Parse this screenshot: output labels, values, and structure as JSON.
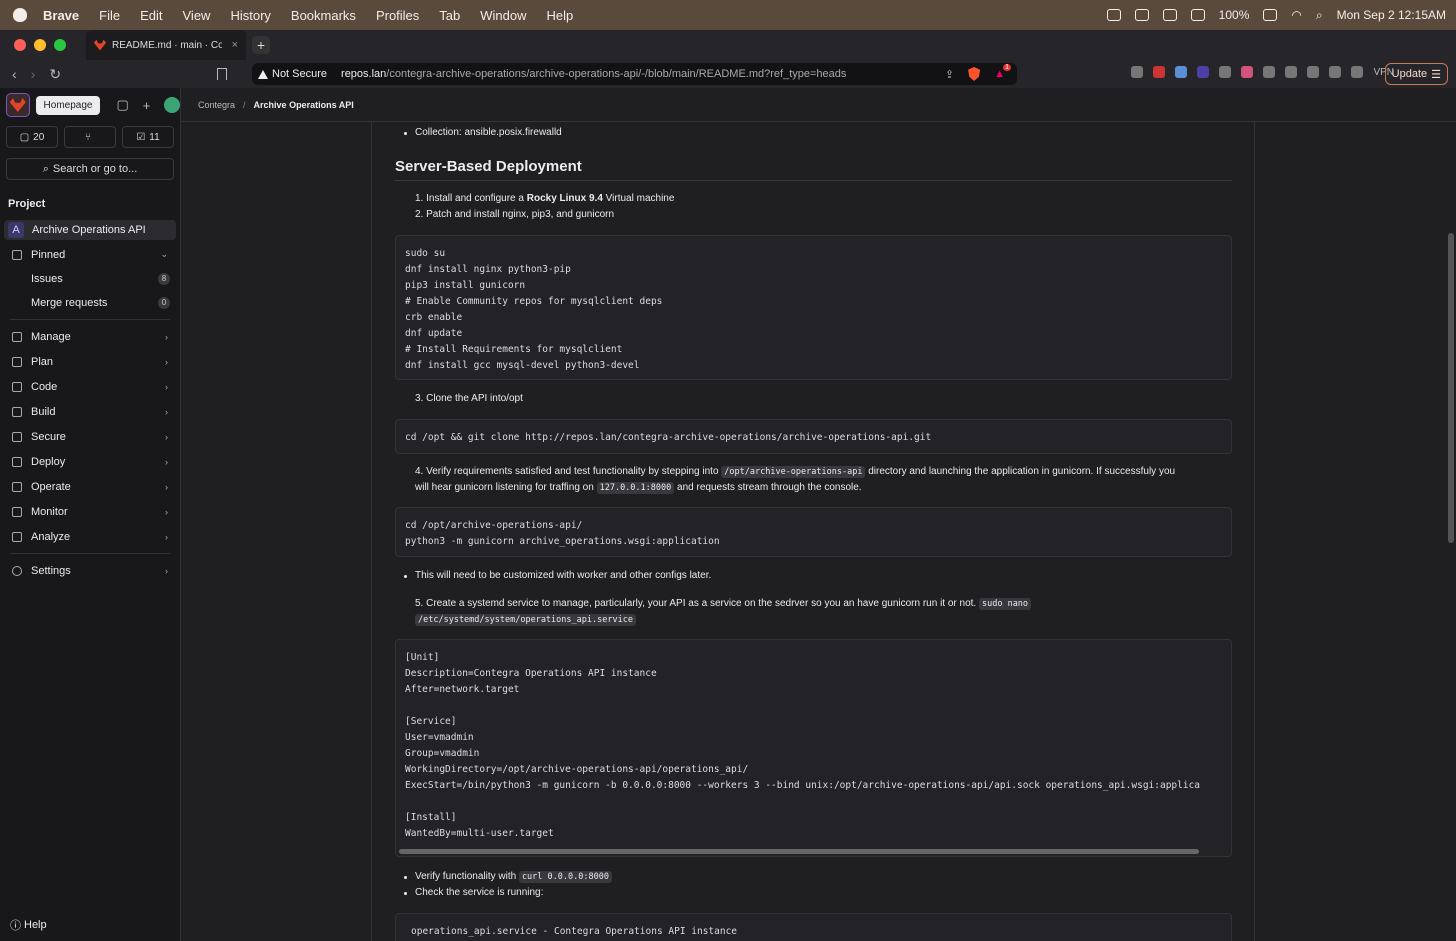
{
  "menubar": {
    "app": "Brave",
    "items": [
      "File",
      "Edit",
      "View",
      "History",
      "Bookmarks",
      "Profiles",
      "Tab",
      "Window",
      "Help"
    ],
    "battery": "100%",
    "datetime": "Mon Sep 2  12:15AM"
  },
  "browser": {
    "tab_title": "README.md · main · Contegra",
    "security": "Not Secure",
    "url_host": "repos.lan",
    "url_path": "/contegra-archive-operations/archive-operations-api/-/blob/main/README.md?ref_type=heads",
    "shield_badge": "1",
    "vpn": "VPN",
    "update": "Update"
  },
  "sidebar": {
    "tooltip": "Homepage",
    "counts": {
      "issues": "20",
      "mrs": "",
      "todos": "11"
    },
    "search": "Search or go to...",
    "section": "Project",
    "project_avatar": "A",
    "project_name": "Archive Operations API",
    "pinned": "Pinned",
    "issues": "Issues",
    "issues_count": "8",
    "merge_requests": "Merge requests",
    "mr_count": "0",
    "nav": [
      "Manage",
      "Plan",
      "Code",
      "Build",
      "Secure",
      "Deploy",
      "Operate",
      "Monitor",
      "Analyze"
    ],
    "settings": "Settings",
    "help": "Help"
  },
  "breadcrumb": {
    "group": "Contegra",
    "project": "Archive Operations API"
  },
  "doc": {
    "collection": "Collection: ansible.posix.firewalld",
    "heading": "Server-Based Deployment",
    "step1_a": "1. Install and configure a ",
    "step1_b": "Rocky Linux 9.4",
    "step1_c": " Virtual machine",
    "step2": "2. Patch and install nginx, pip3, and gunicorn",
    "code1": "sudo su\ndnf install nginx python3-pip\npip3 install gunicorn\n# Enable Community repos for mysqlclient deps\ncrb enable\ndnf update\n# Install Requirements for mysqlclient\ndnf install gcc mysql-devel python3-devel",
    "step3": "3. Clone the API into/opt",
    "code2": "cd /opt && git clone http://repos.lan/contegra-archive-operations/archive-operations-api.git",
    "step4_a": "4. Verify requirements satisfied and test functionality by stepping into ",
    "step4_code1": "/opt/archive-operations-api",
    "step4_b": " directory and launching the application in gunicorn. If successfuly you",
    "step4_c": "will hear gunicorn listening for traffing on ",
    "step4_code2": "127.0.0.1:8000",
    "step4_d": " and requests stream through the console.",
    "code3": "cd /opt/archive-operations-api/\npython3 -m gunicorn archive_operations.wsgi:application",
    "note": "This will need to be customized with worker and other configs later.",
    "step5_a": "5. Create a systemd service to manage, particularly, your API as a service on the sedrver so you an have gunicorn run it or not. ",
    "step5_code1": "sudo nano",
    "step5_code2": "/etc/systemd/system/operations_api.service",
    "code4": "[Unit]\nDescription=Contegra Operations API instance\nAfter=network.target\n\n[Service]\nUser=vmadmin\nGroup=vmadmin\nWorkingDirectory=/opt/archive-operations-api/operations_api/\nExecStart=/bin/python3 -m gunicorn -b 0.0.0.0:8000 --workers 3 --bind unix:/opt/archive-operations-api/api.sock operations_api.wsgi:applica\n\n[Install]\nWantedBy=multi-user.target",
    "verify_a": "Verify functionality with ",
    "verify_code": "curl 0.0.0.0:8000",
    "check": "Check the service is running:",
    "code5": "operations_api.service - Contegra Operations API instance"
  }
}
